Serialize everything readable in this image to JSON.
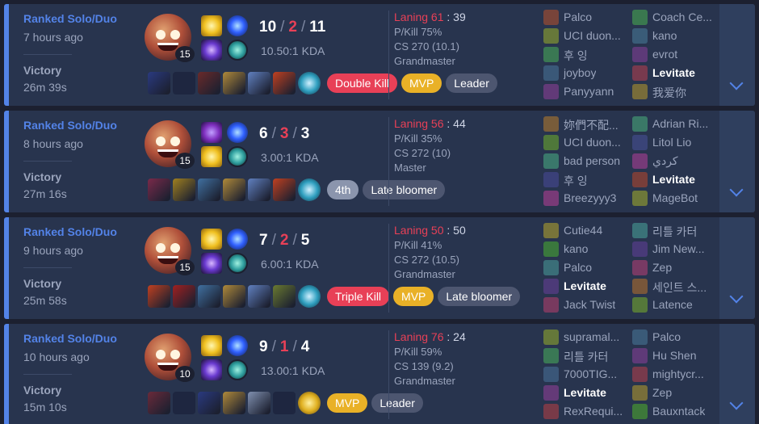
{
  "matches": [
    {
      "mode": "Ranked Solo/Duo",
      "time_ago": "7 hours ago",
      "result": "Victory",
      "duration": "26m 39s",
      "level": "15",
      "kills": "10",
      "deaths": "2",
      "assists": "11",
      "kda_ratio": "10.50:1 KDA",
      "badges": [
        {
          "label": "Double Kill",
          "style": "red"
        },
        {
          "label": "MVP",
          "style": "mvp"
        },
        {
          "label": "Leader",
          "style": "gray"
        }
      ],
      "laning_label": "Laning 61",
      "laning_value": ": 39",
      "pkill": "P/Kill 75%",
      "cs": "CS 270 (10.1)",
      "tier": "Grandmaster",
      "team_blue": [
        "Palco",
        "UCI duon...",
        "후 잉",
        "joyboy",
        "Panyyann"
      ],
      "team_red": [
        "Coach Ce...",
        "kano",
        "evrot",
        "Levitate",
        "我爱你"
      ],
      "me_red_index": 3,
      "me_blue_index": -1,
      "spell1": "flash",
      "spell2": "ignite",
      "items": [
        "#2a3a80",
        "empty",
        "#6a2a2a",
        "#b08a3a",
        "#6080c0",
        "#c04020",
        "ward"
      ]
    },
    {
      "mode": "Ranked Solo/Duo",
      "time_ago": "8 hours ago",
      "result": "Victory",
      "duration": "27m 16s",
      "level": "15",
      "kills": "6",
      "deaths": "3",
      "assists": "3",
      "kda_ratio": "3.00:1 KDA",
      "badges": [
        {
          "label": "4th",
          "style": "rank"
        },
        {
          "label": "Late bloomer",
          "style": "gray"
        }
      ],
      "laning_label": "Laning 56",
      "laning_value": ": 44",
      "pkill": "P/Kill 35%",
      "cs": "CS 272 (10)",
      "tier": "Master",
      "team_blue": [
        "妳們不配...",
        "UCI duon...",
        "bad person",
        "후 잉",
        "Breezyyy3"
      ],
      "team_red": [
        "Adrian Ri...",
        "Litol Lio",
        "كردي",
        "Levitate",
        "MageBot"
      ],
      "me_red_index": 3,
      "me_blue_index": -1,
      "spell1": "teleport",
      "spell2": "flash",
      "items": [
        "#7a2a4a",
        "#a08020",
        "#4070a0",
        "#b08a3a",
        "#6080c0",
        "#c04020",
        "ward"
      ]
    },
    {
      "mode": "Ranked Solo/Duo",
      "time_ago": "9 hours ago",
      "result": "Victory",
      "duration": "25m 58s",
      "level": "15",
      "kills": "7",
      "deaths": "2",
      "assists": "5",
      "kda_ratio": "6.00:1 KDA",
      "badges": [
        {
          "label": "Triple Kill",
          "style": "red"
        },
        {
          "label": "MVP",
          "style": "mvp"
        },
        {
          "label": "Late bloomer",
          "style": "gray"
        }
      ],
      "laning_label": "Laning 50",
      "laning_value": ": 50",
      "pkill": "P/Kill 41%",
      "cs": "CS 272 (10.5)",
      "tier": "Grandmaster",
      "team_blue": [
        "Cutie44",
        "kano",
        "Palco",
        "Levitate",
        "Jack Twist"
      ],
      "team_red": [
        "리틀 카터",
        "Jim New...",
        "Zep",
        "세인트 스...",
        "Latence"
      ],
      "me_red_index": -1,
      "me_blue_index": 3,
      "spell1": "flash",
      "spell2": "ignite",
      "items": [
        "#c04020",
        "#a02020",
        "#4070a0",
        "#b08a3a",
        "#6080c0",
        "#6a7a30",
        "ward"
      ]
    },
    {
      "mode": "Ranked Solo/Duo",
      "time_ago": "10 hours ago",
      "result": "Victory",
      "duration": "15m 10s",
      "level": "10",
      "kills": "9",
      "deaths": "1",
      "assists": "4",
      "kda_ratio": "13.00:1 KDA",
      "badges": [
        {
          "label": "MVP",
          "style": "mvp"
        },
        {
          "label": "Leader",
          "style": "gray"
        }
      ],
      "laning_label": "Laning 76",
      "laning_value": ": 24",
      "pkill": "P/Kill 59%",
      "cs": "CS 139 (9.2)",
      "tier": "Grandmaster",
      "team_blue": [
        "supramal...",
        "리틀 카터",
        "7000TIG...",
        "Levitate",
        "RexRequi..."
      ],
      "team_red": [
        "Palco",
        "Hu Shen",
        "mightycr...",
        "Zep",
        "Bauxntack"
      ],
      "me_red_index": -1,
      "me_blue_index": 3,
      "spell1": "flash",
      "spell2": "ignite",
      "items": [
        "#6a2a3a",
        "empty",
        "#2a3a80",
        "#b08a3a",
        "#8090b0",
        "empty",
        "ward-gold"
      ]
    }
  ]
}
